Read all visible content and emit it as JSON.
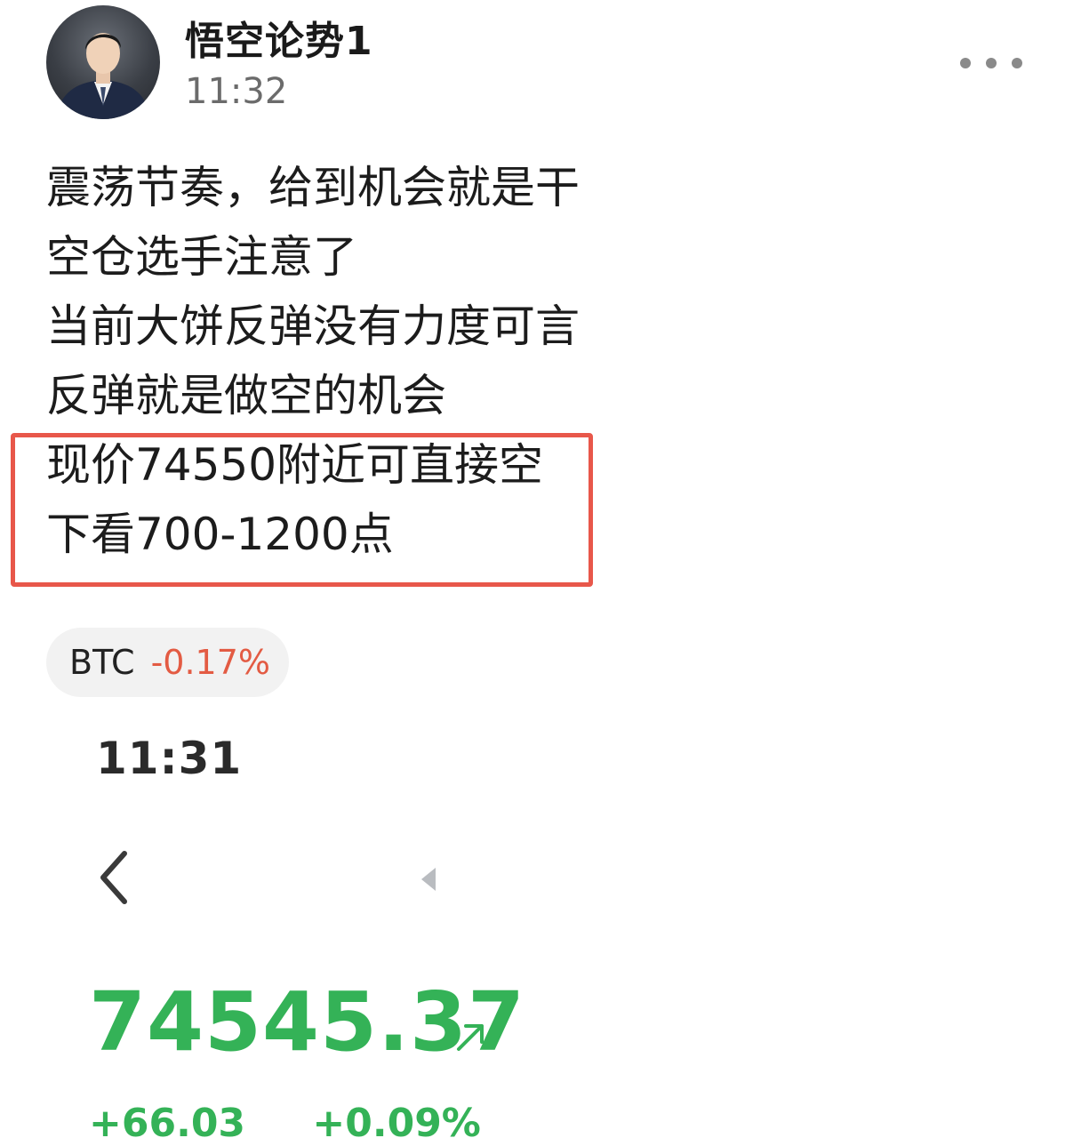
{
  "post": {
    "author": "悟空论势1",
    "time": "11:32",
    "lines": [
      "震荡节奏，给到机会就是干",
      "空仓选手注意了",
      "当前大饼反弹没有力度可言",
      "反弹就是做空的机会",
      "现价74550附近可直接空",
      "下看700-1200点"
    ],
    "highlight_color": "#e8574a"
  },
  "ticker": {
    "symbol": "BTC",
    "change": "-0.17%",
    "change_color": "#e35b43"
  },
  "embed": {
    "time": "11:31",
    "price": "74545.37",
    "price_color": "#34b257",
    "change_abs": "+66.03",
    "change_pct": "+0.09%"
  },
  "icons": {
    "more": "more-horizontal-icon",
    "back": "chevron-left-icon",
    "play_left": "triangle-left-icon",
    "trend": "arrow-up-right-icon"
  }
}
